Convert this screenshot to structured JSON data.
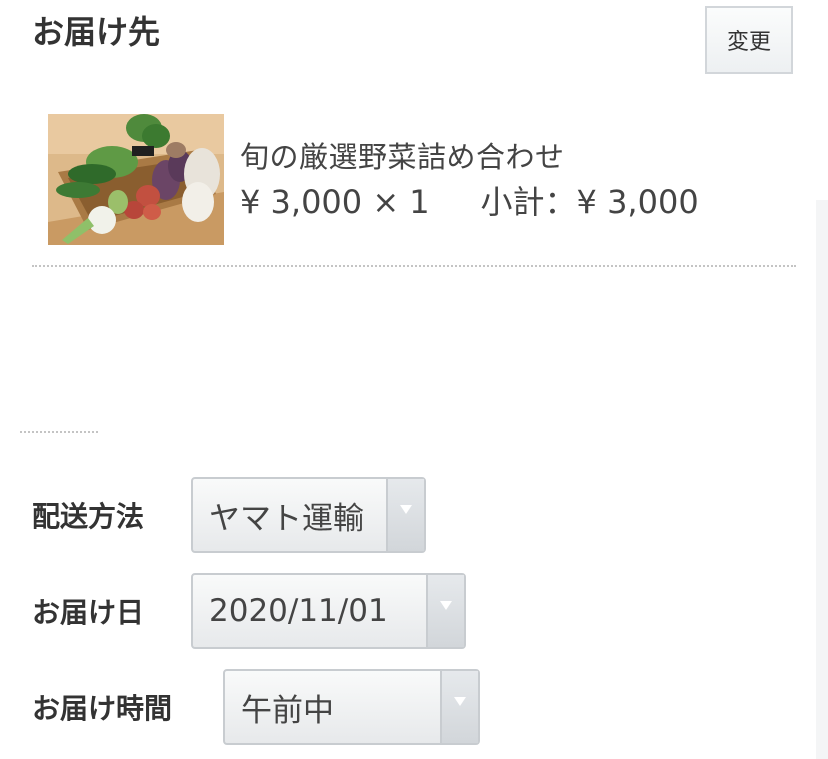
{
  "delivery": {
    "title": "お届け先",
    "change_label": "変更"
  },
  "product": {
    "image_icon": "vegetable-basket-photo",
    "name": "旬の厳選野菜詰め合わせ",
    "unit_price": "¥ 3,000",
    "quantity_text": "× 1",
    "subtotal_label": "小計：",
    "subtotal_value": "¥ 3,000"
  },
  "shipping_method": {
    "label": "配送方法",
    "value": "ヤマト運輸"
  },
  "delivery_date": {
    "label": "お届け日",
    "value": "2020/11/01"
  },
  "delivery_time": {
    "label": "お届け時間",
    "value": "午前中"
  },
  "colors": {
    "text": "#333333",
    "select_border": "#c8ccd0",
    "divider": "#c4c4c4"
  }
}
